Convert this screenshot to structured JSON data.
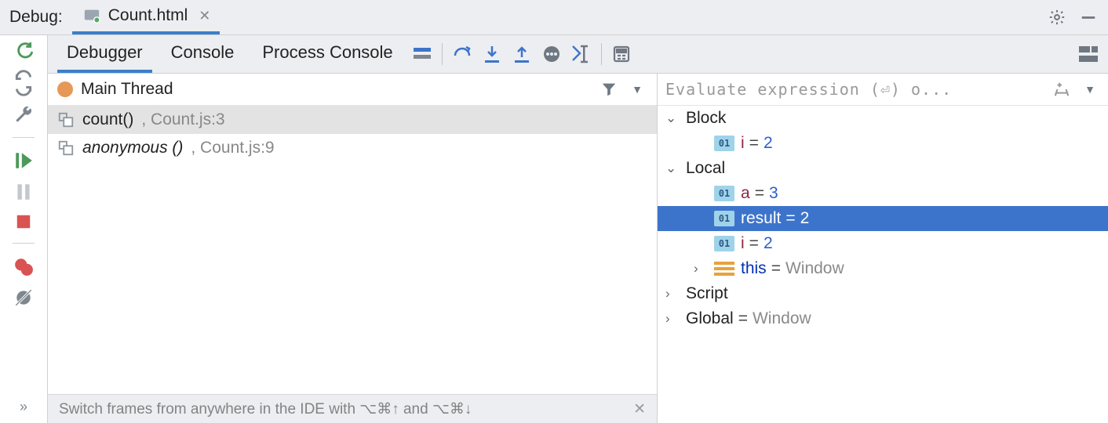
{
  "header": {
    "label": "Debug:",
    "tab": "Count.html"
  },
  "toolbar": {
    "tabs": [
      "Debugger",
      "Console",
      "Process Console"
    ]
  },
  "frames_title": "Main Thread",
  "frames": [
    {
      "fn": "count()",
      "sep": ", ",
      "loc": "Count.js:3",
      "italic": false,
      "sel": true
    },
    {
      "fn": "anonymous ()",
      "sep": ", ",
      "loc": "Count.js:9",
      "italic": true,
      "sel": false
    }
  ],
  "hint": "Switch frames from anywhere in the IDE with ⌥⌘↑ and ⌥⌘↓",
  "var_placeholder": "Evaluate expression (⏎) o...",
  "vars": [
    {
      "type": "scope",
      "depth": 0,
      "open": true,
      "name": "Block"
    },
    {
      "type": "var",
      "depth": 1,
      "key": "i",
      "val": "2",
      "kind": "num",
      "sel": false
    },
    {
      "type": "scope",
      "depth": 0,
      "open": true,
      "name": "Local"
    },
    {
      "type": "var",
      "depth": 1,
      "key": "a",
      "val": "3",
      "kind": "num",
      "sel": false
    },
    {
      "type": "var",
      "depth": 1,
      "key": "result",
      "val": "2",
      "kind": "num",
      "sel": true
    },
    {
      "type": "var",
      "depth": 1,
      "key": "i",
      "val": "2",
      "kind": "num",
      "sel": false
    },
    {
      "type": "obj",
      "depth": 1,
      "key": "this",
      "val": "Window",
      "keyword": true
    },
    {
      "type": "scope",
      "depth": 0,
      "open": false,
      "name": "Script"
    },
    {
      "type": "scopeval",
      "depth": 0,
      "open": false,
      "name": "Global",
      "val": "Window"
    }
  ]
}
